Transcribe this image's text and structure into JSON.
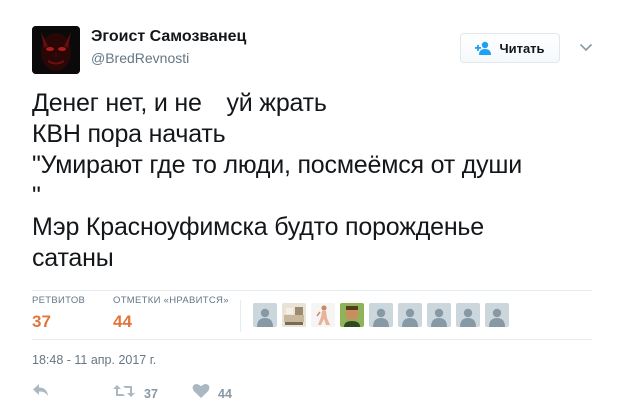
{
  "header": {
    "display_name": "Эгоист Самозванец",
    "screen_name": "@BredRevnosti",
    "follow_label": "Читать"
  },
  "tweet": {
    "lines": [
      "Денег нет, и не уй жрать",
      "КВН пора начать",
      "\"Умирают где то люди, посмеёмся от души",
      "\"",
      "Мэр Красноуфимска будто порожденье",
      "сатаны"
    ]
  },
  "stats": {
    "retweets_label": "РЕТВИТОВ",
    "retweets_count": "37",
    "likes_label": "ОТМЕТКИ «НРАВИТСЯ»",
    "likes_count": "44"
  },
  "likers": [
    {
      "type": "default"
    },
    {
      "type": "photo-room"
    },
    {
      "type": "photo-figure"
    },
    {
      "type": "photo-face"
    },
    {
      "type": "default"
    },
    {
      "type": "default"
    },
    {
      "type": "default"
    },
    {
      "type": "default"
    },
    {
      "type": "default"
    }
  ],
  "timestamp": "18:48 - 11 апр. 2017 г.",
  "actions": {
    "retweet_count": "37",
    "like_count": "44"
  },
  "colors": {
    "stat_value": "#e0763b",
    "secondary_text": "#657786",
    "icon_gray": "#aab8c2",
    "brand_blue": "#1da1f2"
  }
}
